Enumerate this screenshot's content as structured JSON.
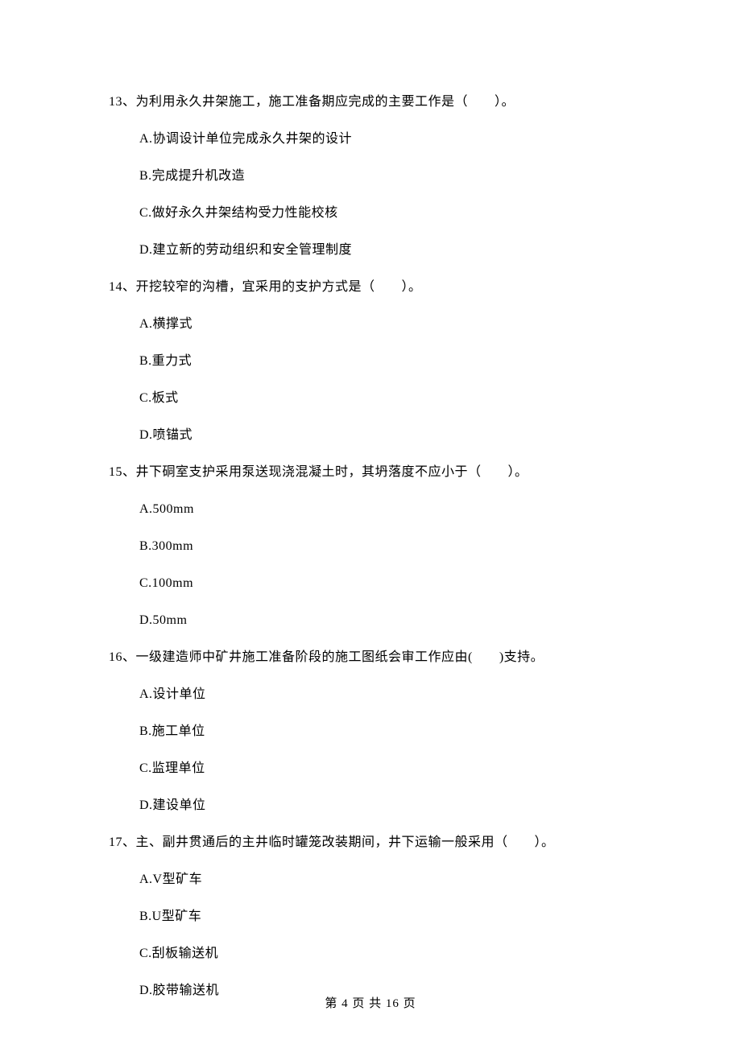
{
  "questions": [
    {
      "number": "13、",
      "stem": "为利用永久井架施工，施工准备期应完成的主要工作是（　　）。",
      "options": [
        "A.协调设计单位完成永久井架的设计",
        "B.完成提升机改造",
        "C.做好永久井架结构受力性能校核",
        "D.建立新的劳动组织和安全管理制度"
      ]
    },
    {
      "number": "14、",
      "stem": "开挖较窄的沟槽，宜采用的支护方式是（　　）。",
      "options": [
        "A.横撑式",
        "B.重力式",
        "C.板式",
        "D.喷锚式"
      ]
    },
    {
      "number": "15、",
      "stem": "井下硐室支护采用泵送现浇混凝土时，其坍落度不应小于（　　）。",
      "options": [
        "A.500mm",
        "B.300mm",
        "C.100mm",
        "D.50mm"
      ]
    },
    {
      "number": "16、",
      "stem": "一级建造师中矿井施工准备阶段的施工图纸会审工作应由(　　)支持。",
      "options": [
        "A.设计单位",
        "B.施工单位",
        "C.监理单位",
        "D.建设单位"
      ]
    },
    {
      "number": "17、",
      "stem": "主、副井贯通后的主井临时罐笼改装期间，井下运输一般采用（　　）。",
      "options": [
        "A.V型矿车",
        "B.U型矿车",
        "C.刮板输送机",
        "D.胶带输送机"
      ]
    }
  ],
  "footer": "第 4 页 共 16 页"
}
